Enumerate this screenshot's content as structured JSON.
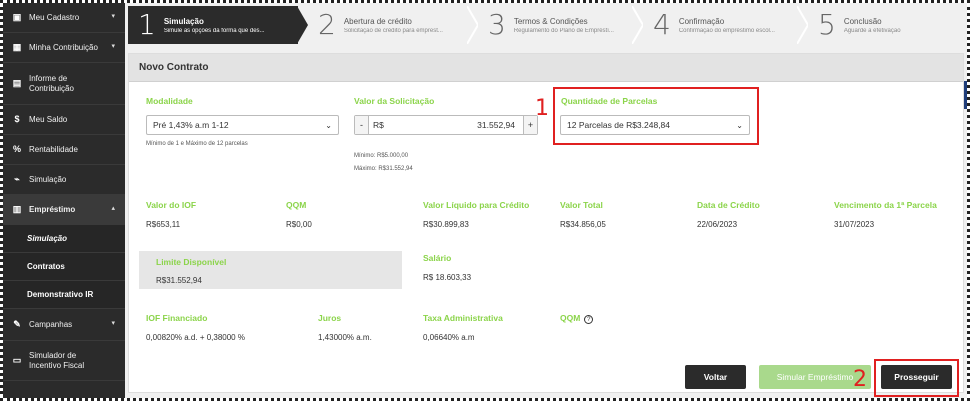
{
  "sidebar": {
    "items": [
      {
        "icon": "id-card-icon",
        "glyph": "▣",
        "label": "Meu Cadastro",
        "chev": "▾"
      },
      {
        "icon": "calculator-icon",
        "glyph": "▦",
        "label": "Minha Contribuição",
        "chev": "▾"
      },
      {
        "icon": "document-icon",
        "glyph": "▤",
        "label": "Informe de Contribuição",
        "chev": ""
      },
      {
        "icon": "dollar-icon",
        "glyph": "$",
        "label": "Meu Saldo",
        "chev": ""
      },
      {
        "icon": "percent-icon",
        "glyph": "%",
        "label": "Rentabilidade",
        "chev": ""
      },
      {
        "icon": "chart-icon",
        "glyph": "⌁",
        "label": "Simulação",
        "chev": ""
      },
      {
        "icon": "bank-icon",
        "glyph": "▥",
        "label": "Empréstimo",
        "chev": "▴"
      }
    ],
    "sub_items": [
      "Simulação",
      "Contratos",
      "Demonstrativo IR"
    ],
    "bottom_items": [
      {
        "icon": "edit-icon",
        "glyph": "✎",
        "label": "Campanhas",
        "chev": "▾"
      },
      {
        "icon": "calculator-icon",
        "glyph": "▭",
        "label": "Simulador de Incentivo Fiscal",
        "chev": ""
      }
    ]
  },
  "stepper": [
    {
      "num": "1",
      "title": "Simulação",
      "subtitle": "Simule as opções da forma que des..."
    },
    {
      "num": "2",
      "title": "Abertura de crédito",
      "subtitle": "Solicitação de crédito para emprest..."
    },
    {
      "num": "3",
      "title": "Termos & Condições",
      "subtitle": "Regulamento do Plano de Empréstí..."
    },
    {
      "num": "4",
      "title": "Confirmação",
      "subtitle": "Confirmação do empréstimo escol..."
    },
    {
      "num": "5",
      "title": "Conclusão",
      "subtitle": "Aguarde a efetivação"
    }
  ],
  "card": {
    "title": "Novo Contrato",
    "modalidade": {
      "label": "Modalidade",
      "value": "Pré 1,43% a.m 1-12",
      "hint": "Mínimo de 1 e Máximo de 12 parcelas"
    },
    "valor_solicitacao": {
      "label": "Valor da Solicitação",
      "minus": "-",
      "currency": "R$",
      "value": "31.552,94",
      "plus": "+",
      "min": "Mínimo: R$5.000,00",
      "max": "Máximo: R$31.552,94"
    },
    "parcelas": {
      "label": "Quantidade de Parcelas",
      "value": "12 Parcelas de R$3.248,84"
    },
    "row1": [
      {
        "label": "Valor do IOF",
        "value": "R$653,11"
      },
      {
        "label": "QQM",
        "value": "R$0,00"
      },
      {
        "label": "Valor Líquido para Crédito",
        "value": "R$30.899,83"
      },
      {
        "label": "Valor Total",
        "value": "R$34.856,05"
      },
      {
        "label": "Data de Crédito",
        "value": "22/06/2023"
      },
      {
        "label": "Vencimento da 1ª Parcela",
        "value": "31/07/2023"
      }
    ],
    "limite": {
      "label": "Limite Disponível",
      "value": "R$31.552,94"
    },
    "salario": {
      "label": "Salário",
      "value": "R$ 18.603,33"
    },
    "row3": [
      {
        "label": "IOF Financiado",
        "value": "0,00820% a.d. + 0,38000 %"
      },
      {
        "label": "Juros",
        "value": "1,43000% a.m."
      },
      {
        "label": "Taxa Administrativa",
        "value": "0,06640% a.m"
      },
      {
        "label": "QQM",
        "value": ""
      }
    ],
    "help_glyph": "?"
  },
  "buttons": {
    "voltar": "Voltar",
    "simular": "Simular Empréstimo",
    "prosseguir": "Prosseguir"
  },
  "annotations": {
    "one": "1",
    "two": "2"
  },
  "colors": {
    "accent_green": "#8bd44a",
    "dark": "#2b2b2b",
    "highlight_red": "#e02020"
  }
}
